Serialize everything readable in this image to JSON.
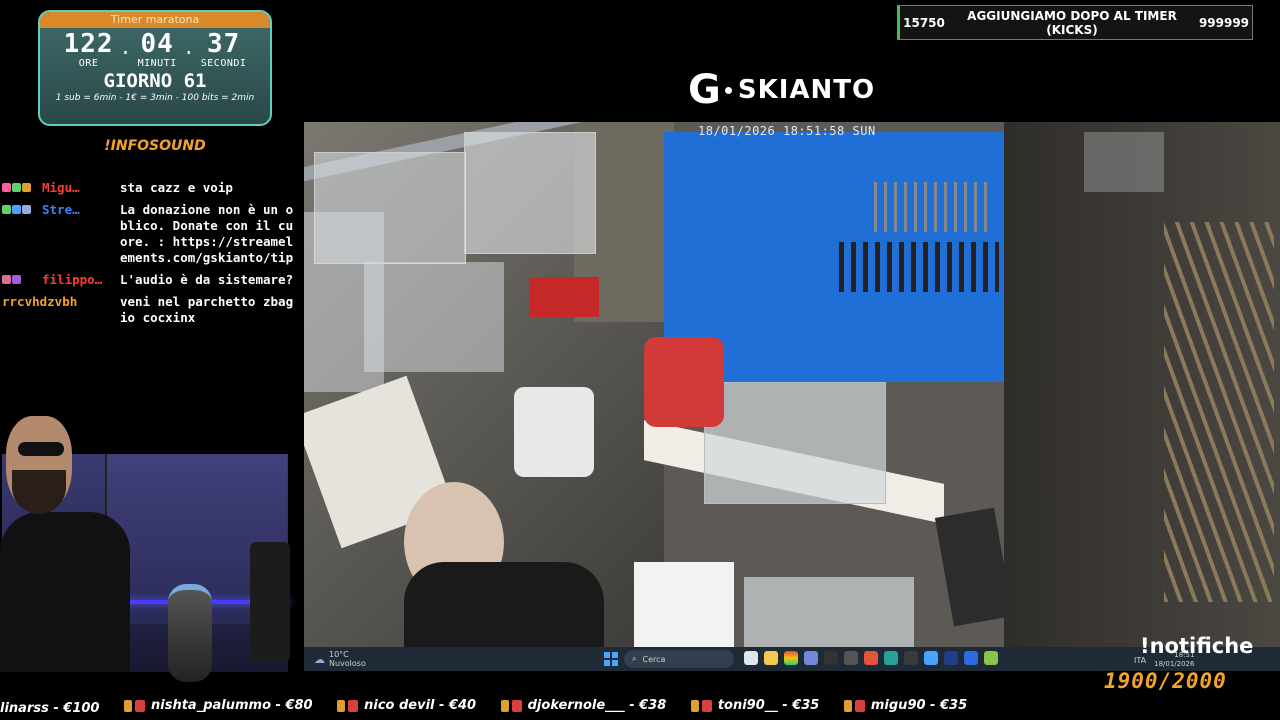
{
  "timer": {
    "title": "Timer maratona",
    "hours": "122",
    "minutes": "04",
    "seconds": "37",
    "hours_label": "ORE",
    "minutes_label": "MINUTI",
    "seconds_label": "SECONDI",
    "day": "GIORNO 61",
    "rates": "1 sub = 6min - 1€ = 3min - 100 bits = 2min"
  },
  "infosound": "!INFOSOUND",
  "chat": [
    {
      "user": "Migu…",
      "user_color": "#ff3b30",
      "text": "sta cazz e voip"
    },
    {
      "user": "Stre…",
      "user_color": "#3b82f6",
      "text": "La donazione non è un oblico. Donate con il cuore. : https://streamelements.com/gskianto/tip"
    },
    {
      "user": "filippo…",
      "user_color": "#ff3b30",
      "text": "L'audio è da sistemare?"
    },
    {
      "user": "rrcvhdzvbh",
      "user_color": "#f3a32c",
      "text": "veni nel parchetto zbagio cocxinx"
    }
  ],
  "goal_banner": {
    "left": "15750",
    "title": "AGGIUNGIAMO DOPO AL TIMER (KICKS)",
    "right": "999999"
  },
  "logo": {
    "letter": "G",
    "name": "SKIANTO"
  },
  "camera": {
    "timestamp": "18/01/2026 18:51:58 SUN"
  },
  "taskbar": {
    "temp": "10°C",
    "weather": "Nuvoloso",
    "search_placeholder": "Cerca",
    "lang": "ITA",
    "time": "18:51",
    "date": "18/01/2026"
  },
  "notifiche": "!notifiche",
  "sub_goal": "1900/2000",
  "ticker": [
    "linarss - €100",
    "nishta_palummo - €80",
    "nico devil - €40",
    "djokernole___ - €38",
    "toni90__ - €35",
    "migu90 - €35"
  ]
}
